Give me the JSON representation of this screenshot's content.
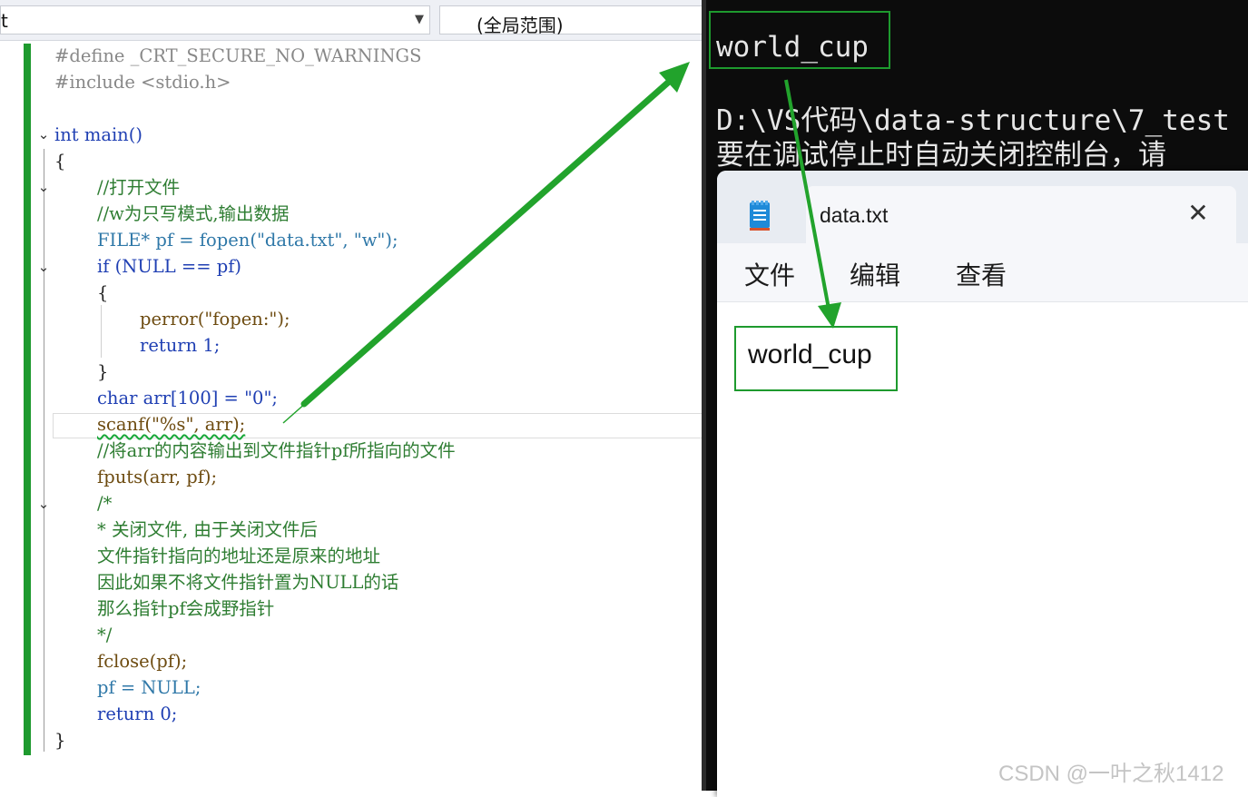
{
  "editor": {
    "nav_left_value": "t",
    "nav_right_value": "(全局范围)",
    "code_lines": [
      "#define _CRT_SECURE_NO_WARNINGS",
      "#include <stdio.h>",
      "",
      "int main()",
      "{",
      "//打开文件",
      "//w为只写模式,输出数据",
      "FILE* pf = fopen(\"data.txt\", \"w\");",
      "if (NULL == pf)",
      "{",
      "perror(\"fopen:\");",
      "return 1;",
      "}",
      "char arr[100] = \"0\";",
      "scanf(\"%s\", arr);",
      "//将arr的内容输出到文件指针pf所指向的文件",
      "fputs(arr, pf);",
      "/*",
      "* 关闭文件, 由于关闭文件后",
      "文件指针指向的地址还是原来的地址",
      "因此如果不将文件指针置为NULL的话",
      "那么指针pf会成野指针",
      "*/",
      "fclose(pf);",
      "pf = NULL;",
      "return 0;",
      "}"
    ]
  },
  "console": {
    "output": "world_cup",
    "path_line": "D:\\VS代码\\data-structure\\7_test",
    "message_line": "要在调试停止时自动关闭控制台，请"
  },
  "notepad": {
    "tab_title": "data.txt",
    "close_glyph": "✕",
    "menu": [
      "文件",
      "编辑",
      "查看"
    ],
    "content": "world_cup"
  },
  "watermark": "CSDN @一叶之秋1412",
  "colors": {
    "change_bar": "#1e9a2e",
    "arrow": "#22a32c",
    "highlight_box": "#1e9a2e",
    "console_bg": "#0c0c0c"
  },
  "icons": {
    "fold": "chevron-down-icon",
    "notepad": "notepad-icon",
    "close": "close-icon",
    "dropdown": "dropdown-caret-icon"
  }
}
